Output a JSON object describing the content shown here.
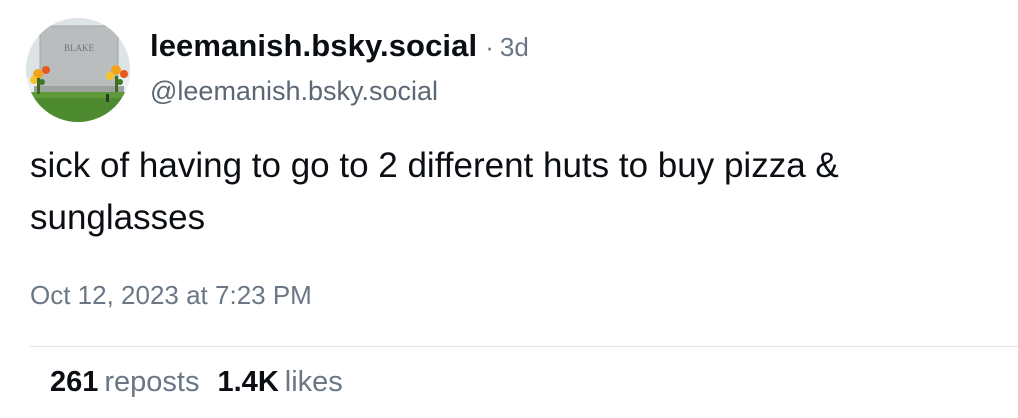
{
  "author": {
    "display_name": "leemanish.bsky.social",
    "handle": "@leemanish.bsky.social",
    "time_ago": "3d",
    "separator": "·",
    "avatar_text": "BLAKE"
  },
  "post": {
    "text": "sick of having to go to 2 different huts to buy pizza & sunglasses",
    "timestamp": "Oct 12, 2023 at 7:23 PM"
  },
  "stats": {
    "reposts_count": "261",
    "reposts_label": "reposts",
    "likes_count": "1.4K",
    "likes_label": "likes"
  },
  "colors": {
    "text_primary": "#0b0f14",
    "text_secondary": "#6b7785",
    "divider": "#dfe3e8"
  }
}
